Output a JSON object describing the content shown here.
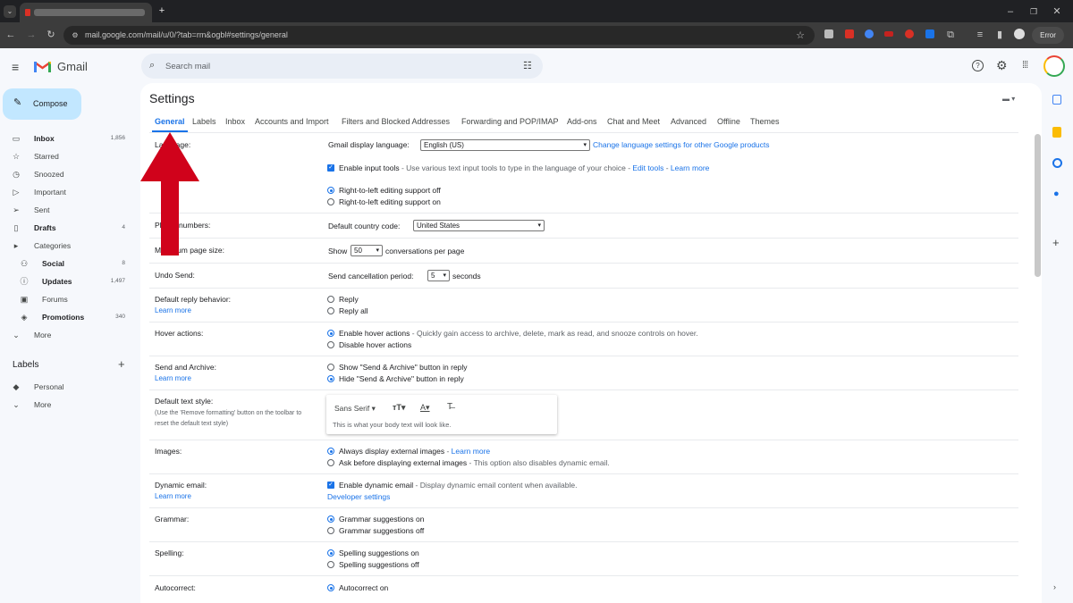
{
  "browser": {
    "url": "mail.google.com/mail/u/0/?tab=rm&ogbl#settings/general",
    "new_tab": "+",
    "error_label": "Error"
  },
  "header": {
    "app_name": "Gmail",
    "search_placeholder": "Search mail"
  },
  "sidebar": {
    "compose": "Compose",
    "items": [
      {
        "label": "Inbox",
        "count": "1,856",
        "icon": "inbox-icon",
        "bold": true
      },
      {
        "label": "Starred",
        "count": "",
        "icon": "star-icon",
        "bold": false
      },
      {
        "label": "Snoozed",
        "count": "",
        "icon": "clock-icon",
        "bold": false
      },
      {
        "label": "Important",
        "count": "",
        "icon": "label-important-icon",
        "bold": false
      },
      {
        "label": "Sent",
        "count": "",
        "icon": "send-icon",
        "bold": false
      },
      {
        "label": "Drafts",
        "count": "4",
        "icon": "draft-icon",
        "bold": true
      },
      {
        "label": "Categories",
        "count": "",
        "icon": "expand-icon",
        "bold": false
      },
      {
        "label": "Social",
        "count": "8",
        "icon": "people-icon",
        "bold": true
      },
      {
        "label": "Updates",
        "count": "1,497",
        "icon": "info-icon",
        "bold": true
      },
      {
        "label": "Forums",
        "count": "",
        "icon": "forum-icon",
        "bold": false
      },
      {
        "label": "Promotions",
        "count": "340",
        "icon": "tag-icon",
        "bold": true
      },
      {
        "label": "More",
        "count": "",
        "icon": "chevron-down-icon",
        "bold": false
      }
    ],
    "labels_heading": "Labels",
    "labels_add": "+",
    "label_items": [
      {
        "label": "Personal",
        "icon": "label-icon"
      },
      {
        "label": "More",
        "icon": "chevron-down-icon"
      }
    ]
  },
  "settings": {
    "title": "Settings",
    "tabs": [
      "General",
      "Labels",
      "Inbox",
      "Accounts and Import",
      "Filters and Blocked Addresses",
      "Forwarding and POP/IMAP",
      "Add-ons",
      "Chat and Meet",
      "Advanced",
      "Offline",
      "Themes"
    ],
    "language": {
      "label": "Language:",
      "display_label": "Gmail display language:",
      "display_value": "English (US)",
      "change_link": "Change language settings for other Google products",
      "input_tools": "Enable input tools",
      "input_tools_desc": " - Use various text input tools to type in the language of your choice - ",
      "edit_tools": "Edit tools",
      "sep": " - ",
      "learn_more": "Learn more",
      "rtl_off": "Right-to-left editing support off",
      "rtl_on": "Right-to-left editing support on"
    },
    "phone": {
      "label": "Phone numbers:",
      "field": "Default country code:",
      "value": "United States"
    },
    "page_size": {
      "label": "Maximum page size:",
      "show": "Show",
      "value": "50",
      "suffix": "conversations per page"
    },
    "undo": {
      "label": "Undo Send:",
      "field": "Send cancellation period:",
      "value": "5",
      "suffix": "seconds"
    },
    "reply": {
      "label": "Default reply behavior:",
      "learn_more": "Learn more",
      "opt1": "Reply",
      "opt2": "Reply all"
    },
    "hover": {
      "label": "Hover actions:",
      "opt1": "Enable hover actions",
      "opt1_desc": " - Quickly gain access to archive, delete, mark as read, and snooze controls on hover.",
      "opt2": "Disable hover actions"
    },
    "send_archive": {
      "label": "Send and Archive:",
      "learn_more": "Learn more",
      "opt1": "Show \"Send & Archive\" button in reply",
      "opt2": "Hide \"Send & Archive\" button in reply"
    },
    "text_style": {
      "label": "Default text style:",
      "desc1": "(Use the 'Remove formatting' button on the toolbar to",
      "desc2": "reset the default text style)",
      "font": "Sans Serif",
      "preview": "This is what your body text will look like."
    },
    "images": {
      "label": "Images:",
      "opt1": "Always display external images",
      "opt1_sep": " - ",
      "opt1_link": "Learn more",
      "opt2": "Ask before displaying external images",
      "opt2_desc": " - This option also disables dynamic email."
    },
    "dynamic": {
      "label": "Dynamic email:",
      "learn_more": "Learn more",
      "opt": "Enable dynamic email",
      "opt_desc": " - Display dynamic email content when available.",
      "dev_link": "Developer settings"
    },
    "grammar": {
      "label": "Grammar:",
      "opt1": "Grammar suggestions on",
      "opt2": "Grammar suggestions off"
    },
    "spelling": {
      "label": "Spelling:",
      "opt1": "Spelling suggestions on",
      "opt2": "Spelling suggestions off"
    },
    "autocorrect": {
      "label": "Autocorrect:",
      "opt1": "Autocorrect on"
    }
  },
  "colors": {
    "accent": "#1a73e8",
    "arrow": "#d0021b",
    "compose_bg": "#c2e7ff"
  }
}
